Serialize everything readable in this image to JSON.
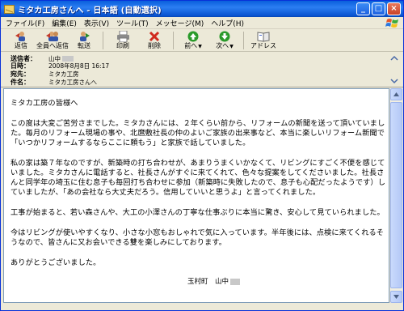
{
  "window": {
    "title": "ミタカ工房さんへ - 日本語 (自動選択)",
    "minimize": "_",
    "maximize": "□",
    "close": "×"
  },
  "menu": [
    "ファイル(F)",
    "編集(E)",
    "表示(V)",
    "ツール(T)",
    "メッセージ(M)",
    "ヘルプ(H)"
  ],
  "toolbar": {
    "reply": "返信",
    "reply_all": "全員へ返信",
    "forward": "転送",
    "print": "印刷",
    "delete": "削除",
    "previous": "前へ",
    "next": "次へ",
    "address": "アドレス"
  },
  "header": {
    "from_label": "送信者：",
    "from_value": "山中",
    "date_label": "日時：",
    "date_value": "2008年8月8日 16:17",
    "to_label": "宛先：",
    "to_value": "ミタカ工房",
    "subject_label": "件名：",
    "subject_value": "ミタカ工房さんへ"
  },
  "message": {
    "greeting": "ミタカ工房の皆様へ",
    "p1": "この度は大変ご苦労さまでした。ミタカさんには、２年くらい前から、リフォームの新聞を送って頂いていました。毎月のリフォーム現場の事や、北麿敷社長の仲のよいご家族の出来事など、本当に楽しいリフォーム新聞で「いつかリフォームするならここに頼もう」と家族で話していました。",
    "p2": "私の家は築７年なのですが、新築時の打ち合わせが、あまりうまくいかなくて、リビングにすごく不便を感じていました。ミタカさんに電話すると、社長さんがすぐに来てくれて、色々な提案をしてくださいました。社長さんと同学年の埼玉に住む息子も毎回打ち合わせに参加（新築時に失敗したので、息子も心配だったようです）していましたが、「あの会社なら大丈夫だろう。信用していいと思うよ」と言ってくれました。",
    "p3": "工事が始まると、若い森さんや、大工の小澤さんの丁寧な仕事ぶりに本当に驚き、安心して見ていられました。",
    "p4": "今はリビングが使いやすくなり、小さな小窓もおしゃれで気に入っています。半年後には、点検に来てくれるそうなので、皆さんに又お会いできる雙を楽しみにしております。",
    "closing": "ありがとうございました。",
    "signature": "玉村町　山中"
  }
}
